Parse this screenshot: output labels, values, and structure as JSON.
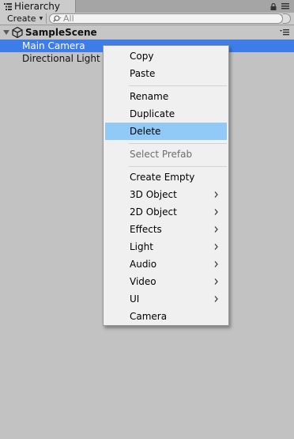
{
  "window": {
    "tab_title": "Hierarchy"
  },
  "toolbar": {
    "create_label": "Create",
    "search_placeholder": "All"
  },
  "hierarchy": {
    "scene_name": "SampleScene",
    "items": [
      {
        "label": "Main Camera",
        "selected": true
      },
      {
        "label": "Directional Light",
        "selected": false
      }
    ]
  },
  "context_menu": {
    "copy": "Copy",
    "paste": "Paste",
    "rename": "Rename",
    "duplicate": "Duplicate",
    "delete": "Delete",
    "select_prefab": "Select Prefab",
    "create_empty": "Create Empty",
    "object_3d": "3D Object",
    "object_2d": "2D Object",
    "effects": "Effects",
    "light": "Light",
    "audio": "Audio",
    "video": "Video",
    "ui": "UI",
    "camera": "Camera",
    "highlighted_item": "Delete",
    "disabled_items": [
      "Select Prefab"
    ]
  },
  "colors": {
    "selection": "#3e7de7",
    "menu_highlight": "#91c9f7",
    "panel_background": "#c2c2c2"
  },
  "icons": {
    "tab": "hierarchy-list-icon",
    "lock": "lock-icon",
    "panel_menu": "panel-menu-icon",
    "search": "search-icon",
    "scene": "unity-scene-icon",
    "submenu": "chevron-right-icon"
  }
}
